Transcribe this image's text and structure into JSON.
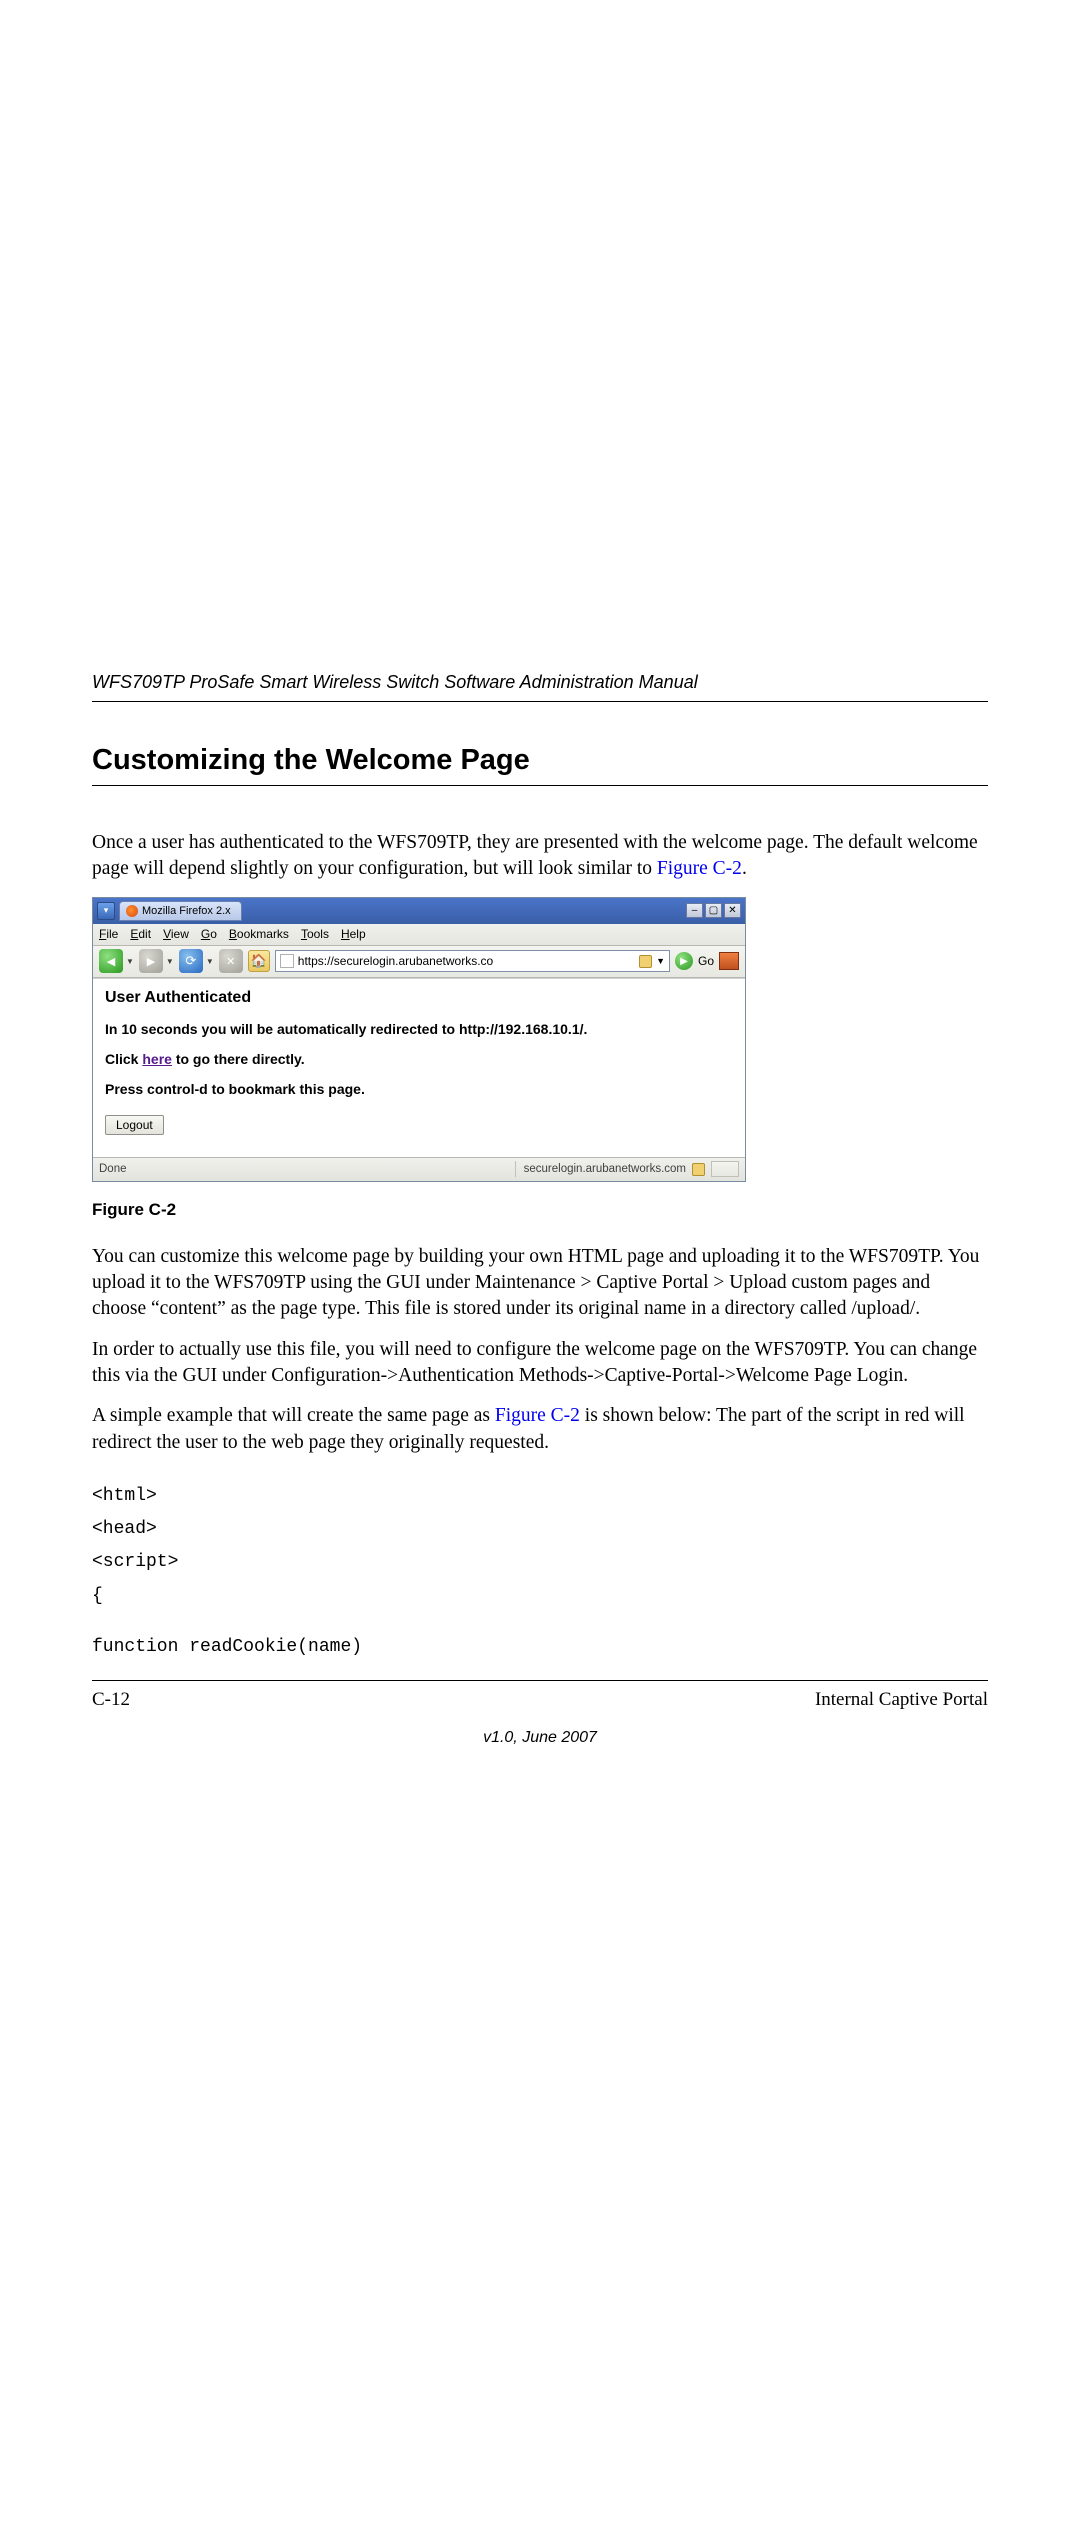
{
  "header": "WFS709TP ProSafe Smart Wireless Switch Software Administration Manual",
  "section_title": "Customizing the Welcome Page",
  "para1": {
    "t1": "Once a user has authenticated to the WFS709TP, they are presented with the welcome page. The default welcome page will depend slightly on your configuration, but will look similar to ",
    "link": "Figure C-2",
    "t2": "."
  },
  "browser": {
    "tab_title": "Mozilla Firefox 2.x",
    "menus": {
      "file": "File",
      "edit": "Edit",
      "view": "View",
      "go": "Go",
      "bookmarks": "Bookmarks",
      "tools": "Tools",
      "help": "Help"
    },
    "url": "https://securelogin.arubanetworks.co",
    "go_label": "Go",
    "content": {
      "title": "User Authenticated",
      "redirect": "In 10 seconds you will be automatically redirected to http://192.168.10.1/.",
      "click_pre": "Click ",
      "click_link": "here",
      "click_post": " to go there directly.",
      "bookmark": "Press control-d to bookmark this page.",
      "logout": "Logout"
    },
    "status": {
      "left": "Done",
      "right": "securelogin.arubanetworks.com"
    }
  },
  "figure_caption": "Figure C-2",
  "para2": "You can customize this welcome page by building your own HTML page and uploading it to the WFS709TP. You upload it to the WFS709TP using the GUI under Maintenance > Captive Portal > Upload custom pages and choose “content” as the page type. This file is stored under its original name in a directory called /upload/.",
  "para3": "In order to actually use this file, you will need to configure the welcome page on the WFS709TP. You can change this via the GUI under Configuration->Authentication Methods->Captive-Portal->Welcome Page Login.",
  "para4": {
    "t1": "A simple example that will create the same page as ",
    "link": "Figure C-2",
    "t2": " is shown below: The part of the script in red will redirect the user to the web page they originally requested."
  },
  "code": {
    "l1": "<html>",
    "l2": "<head>",
    "l3": "<script>",
    "l4": "{",
    "l5": "function readCookie(name)"
  },
  "footer": {
    "left": "C-12",
    "right": "Internal Captive Portal"
  },
  "version": "v1.0, June 2007"
}
